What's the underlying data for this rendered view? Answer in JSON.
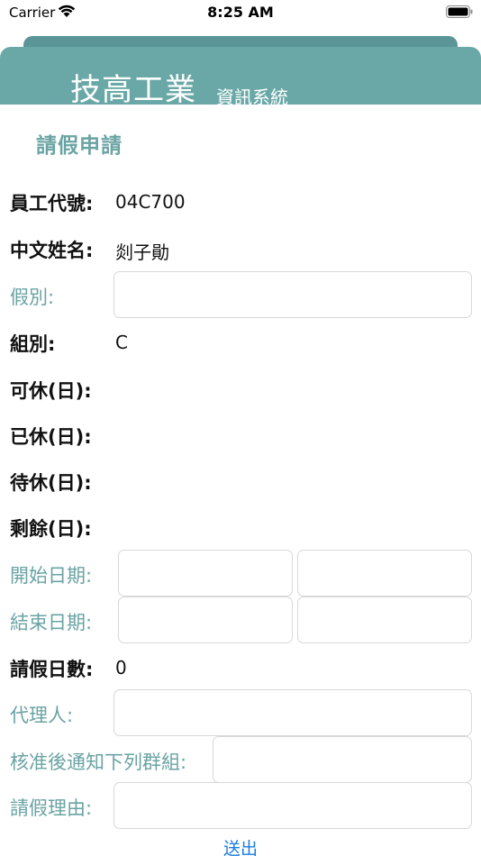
{
  "status_bar": {
    "carrier": "Carrier",
    "time": "8:25 AM"
  },
  "header": {
    "brand_title": "技高工業",
    "brand_subtitle": "資訊系統"
  },
  "page_title": "請假申請",
  "form": {
    "employee_id": {
      "label": "員工代號:",
      "value": "04C700"
    },
    "chinese_name": {
      "label": "中文姓名:",
      "value": "剡子勛"
    },
    "leave_type": {
      "label": "假別:",
      "value": ""
    },
    "group": {
      "label": "組別:",
      "value": "C"
    },
    "available_days": {
      "label": "可休(日):",
      "value": ""
    },
    "used_days": {
      "label": "已休(日):",
      "value": ""
    },
    "pending_days": {
      "label": "待休(日):",
      "value": ""
    },
    "remaining_days": {
      "label": "剩餘(日):",
      "value": ""
    },
    "start_date": {
      "label": "開始日期:",
      "date": "",
      "time": ""
    },
    "end_date": {
      "label": "結束日期:",
      "date": "",
      "time": ""
    },
    "leave_days": {
      "label": "請假日數:",
      "value": "0"
    },
    "agent": {
      "label": "代理人:",
      "value": ""
    },
    "notify_groups": {
      "label": "核准後通知下列群組:",
      "value": ""
    },
    "reason": {
      "label": "請假理由:",
      "value": ""
    }
  },
  "submit_label": "送出",
  "colors": {
    "header_bg": "#6aa8a7",
    "header_back": "#5b9598",
    "teal_text": "#6aa3a3",
    "link_blue": "#1a7ce0"
  }
}
